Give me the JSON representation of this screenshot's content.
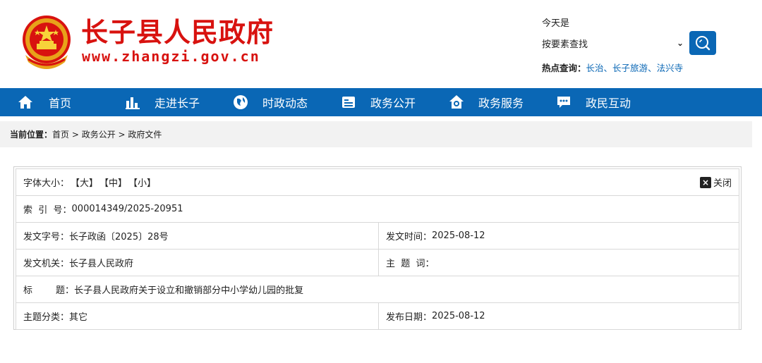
{
  "header": {
    "site_title": "长子县人民政府",
    "site_url": "www.zhangzi.gov.cn",
    "today_label": "今天是",
    "search_select_value": "按要素查找",
    "hot_label": "热点查询：",
    "hot_links": [
      "长治",
      "长子旅游",
      "法兴寺"
    ],
    "hot_sep": "、"
  },
  "nav": {
    "items": [
      {
        "label": "首页",
        "icon": "home-icon"
      },
      {
        "label": "走进长子",
        "icon": "bar-chart-icon"
      },
      {
        "label": "时政动态",
        "icon": "globe-icon"
      },
      {
        "label": "政务公开",
        "icon": "document-icon"
      },
      {
        "label": "政务服务",
        "icon": "house-service-icon"
      },
      {
        "label": "政民互动",
        "icon": "chat-icon"
      }
    ]
  },
  "breadcrumb": {
    "label": "当前位置：",
    "path": [
      "首页",
      "政务公开",
      "政府文件"
    ],
    "sep": " > "
  },
  "info": {
    "font_size_label": "字体大小：",
    "font_size_options": [
      "【大】",
      "【中】",
      "【小】"
    ],
    "close_label": "关闭",
    "index_label": "索  引  号：",
    "index_value": "000014349/2025-20951",
    "doc_no_label": "发文字号：",
    "doc_no_value": "长子政函〔2025〕28号",
    "issue_time_label": "发文时间：",
    "issue_time_value": "2025-08-12",
    "issuer_label": "发文机关：",
    "issuer_value": "长子县人民政府",
    "keyword_label": "主  题  词：",
    "keyword_value": "",
    "title_label": "标        题：",
    "title_value": "长子县人民政府关于设立和撤销部分中小学幼儿园的批复",
    "category_label": "主题分类：",
    "category_value": "其它",
    "publish_date_label": "发布日期：",
    "publish_date_value": "2025-08-12"
  },
  "colors": {
    "brand_red": "#d8120f",
    "nav_blue": "#0a67b5",
    "link_blue": "#0a67b5"
  }
}
